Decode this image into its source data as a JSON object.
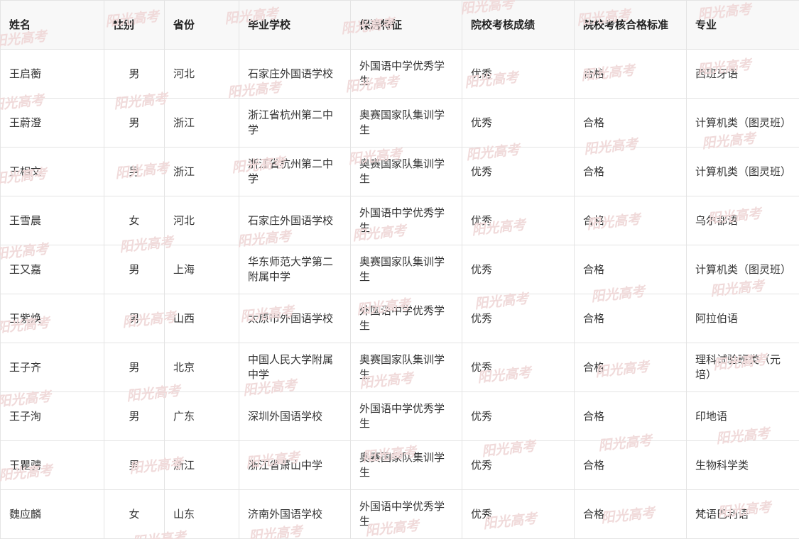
{
  "table": {
    "headers": [
      "姓名",
      "性别",
      "省份",
      "毕业学校",
      "保送特征",
      "院校考核成绩",
      "院校考核合格标准",
      "专业"
    ],
    "rows": [
      [
        "王启蘅",
        "男",
        "河北",
        "石家庄外国语学校",
        "外国语中学优秀学生",
        "优秀",
        "合格",
        "西班牙语"
      ],
      [
        "王蔚澄",
        "男",
        "浙江",
        "浙江省杭州第二中学",
        "奥赛国家队集训学生",
        "优秀",
        "合格",
        "计算机类（图灵班）"
      ],
      [
        "王相文",
        "男",
        "浙江",
        "浙江省杭州第二中学",
        "奥赛国家队集训学生",
        "优秀",
        "合格",
        "计算机类（图灵班）"
      ],
      [
        "王雪晨",
        "女",
        "河北",
        "石家庄外国语学校",
        "外国语中学优秀学生",
        "优秀",
        "合格",
        "乌尔都语"
      ],
      [
        "王又嘉",
        "男",
        "上海",
        "华东师范大学第二附属中学",
        "奥赛国家队集训学生",
        "优秀",
        "合格",
        "计算机类（图灵班）"
      ],
      [
        "王紫焕",
        "男",
        "山西",
        "太原市外国语学校",
        "外国语中学优秀学生",
        "优秀",
        "合格",
        "阿拉伯语"
      ],
      [
        "王子齐",
        "男",
        "北京",
        "中国人民大学附属中学",
        "奥赛国家队集训学生",
        "优秀",
        "合格",
        "理科试验班类（元培）"
      ],
      [
        "王子洵",
        "男",
        "广东",
        "深圳外国语学校",
        "外国语中学优秀学生",
        "优秀",
        "合格",
        "印地语"
      ],
      [
        "王瞿骋",
        "男",
        "浙江",
        "浙江省萧山中学",
        "奥赛国家队集训学生",
        "优秀",
        "合格",
        "生物科学类"
      ],
      [
        "魏应麟",
        "女",
        "山东",
        "济南外国语学校",
        "外国语中学优秀学生",
        "优秀",
        "合格",
        "梵语巴利语"
      ]
    ]
  },
  "watermark": {
    "text": "阳光高考"
  }
}
